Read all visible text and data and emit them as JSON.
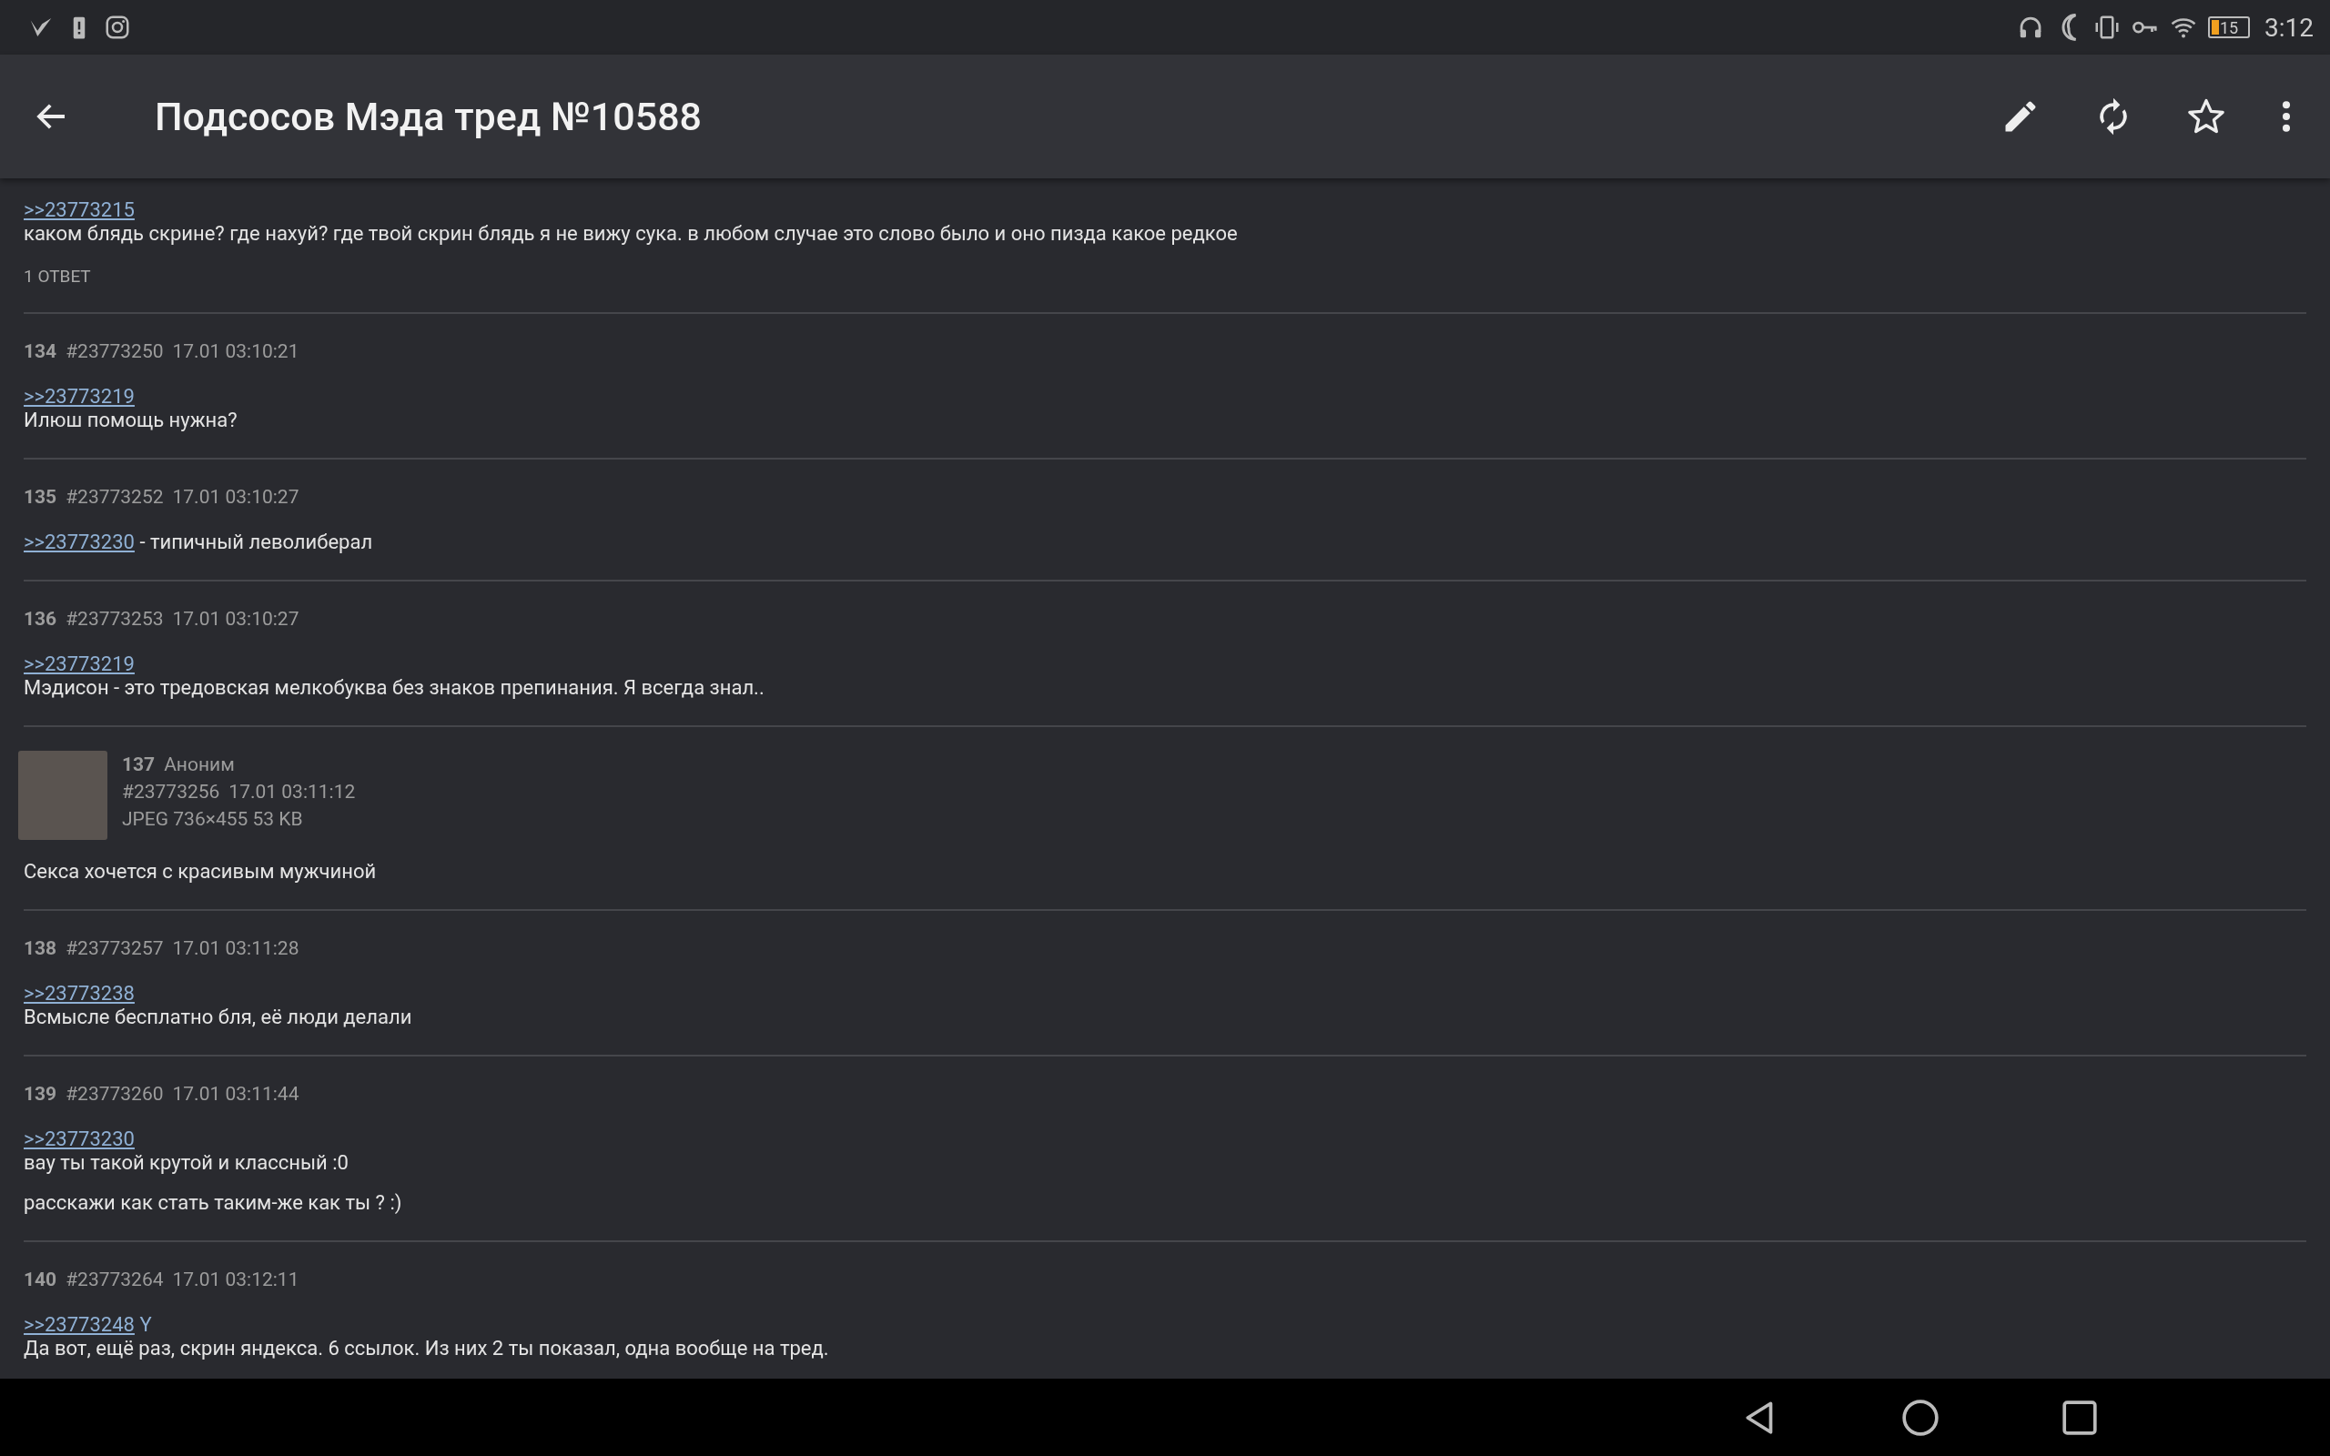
{
  "status_bar": {
    "battery": "15",
    "time": "3:12"
  },
  "app_bar": {
    "title": "Подсосов Мэда тред №10588"
  },
  "posts": [
    {
      "body": [
        {
          "lines": [
            [
              {
                "kind": "link",
                "text": ">>23773215"
              }
            ],
            [
              {
                "kind": "text",
                "text": "каком блядь скрине? где нахуй? где твой скрин блядь я не вижу сука. в любом случае это слово было и оно пизда какое редкое"
              }
            ]
          ]
        }
      ],
      "replies": "1 ОТВЕТ"
    },
    {
      "number": "134",
      "id": "#23773250",
      "date": "17.01 03:10:21",
      "body": [
        {
          "lines": [
            [
              {
                "kind": "link",
                "text": ">>23773219"
              }
            ],
            [
              {
                "kind": "text",
                "text": "Илюш помощь нужна?"
              }
            ]
          ]
        }
      ]
    },
    {
      "number": "135",
      "id": "#23773252",
      "date": "17.01 03:10:27",
      "body": [
        {
          "lines": [
            [
              {
                "kind": "link",
                "text": ">>23773230"
              },
              {
                "kind": "text",
                "text": " - типичный леволиберал"
              }
            ]
          ]
        }
      ]
    },
    {
      "number": "136",
      "id": "#23773253",
      "date": "17.01 03:10:27",
      "body": [
        {
          "lines": [
            [
              {
                "kind": "link",
                "text": ">>23773219"
              }
            ],
            [
              {
                "kind": "text",
                "text": "Мэдисон - это тредовская мелкобуква без знаков препинания. Я всегда знал.."
              }
            ]
          ]
        }
      ]
    },
    {
      "number": "137",
      "name": "Аноним",
      "id": "#23773256",
      "date": "17.01 03:11:12",
      "file": "JPEG 736×455 53 KB",
      "body": [
        {
          "lines": [
            [
              {
                "kind": "text",
                "text": "Секса хочется с красивым мужчиной"
              }
            ]
          ]
        }
      ]
    },
    {
      "number": "138",
      "id": "#23773257",
      "date": "17.01 03:11:28",
      "body": [
        {
          "lines": [
            [
              {
                "kind": "link",
                "text": ">>23773238"
              }
            ],
            [
              {
                "kind": "text",
                "text": "Всмысле бесплатно бля, её люди делали"
              }
            ]
          ]
        }
      ]
    },
    {
      "number": "139",
      "id": "#23773260",
      "date": "17.01 03:11:44",
      "body": [
        {
          "lines": [
            [
              {
                "kind": "link",
                "text": ">>23773230"
              }
            ],
            [
              {
                "kind": "text",
                "text": "вау ты такой крутой и классный :0"
              }
            ]
          ]
        },
        {
          "lines": [
            [
              {
                "kind": "text",
                "text": "расскажи как стать таким-же как ты ? :)"
              }
            ]
          ]
        }
      ]
    },
    {
      "number": "140",
      "id": "#23773264",
      "date": "17.01 03:12:11",
      "body": [
        {
          "lines": [
            [
              {
                "kind": "link",
                "text": ">>23773248"
              },
              {
                "kind": "mark",
                "text": " Y"
              }
            ],
            [
              {
                "kind": "text",
                "text": "Да вот, ещё раз, скрин яндекса. 6 ссылок. Из них 2 ты показал, одна вообще на тред."
              }
            ]
          ]
        }
      ]
    }
  ]
}
